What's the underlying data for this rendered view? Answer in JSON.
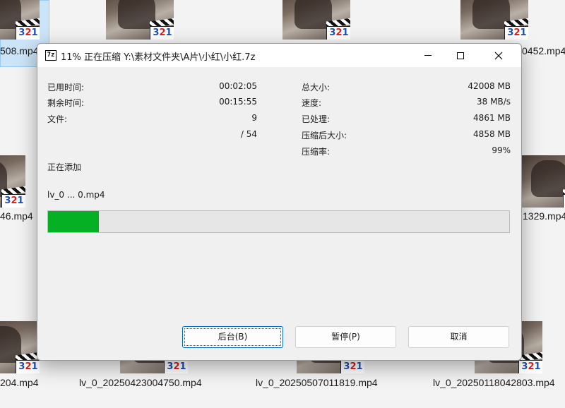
{
  "background": {
    "file_labels_top": [
      "508.mp4",
      "0452.mp4"
    ],
    "file_labels_middle": [
      "46.mp4",
      "1329.mp4"
    ],
    "file_labels_bottom": [
      "204.mp4",
      "lv_0_20250423004750.mp4",
      "lv_0_20250507011819.mp4",
      "lv_0_20250118042803.mp4"
    ],
    "badge_text": "321"
  },
  "dialog": {
    "title": "11% 正在压缩 Y:\\素材文件夹\\A片\\小红\\小红.7z",
    "app_icon_text": "7z",
    "left_stats": [
      {
        "label": "已用时间:",
        "value": "00:02:05"
      },
      {
        "label": "剩余时间:",
        "value": "00:15:55"
      },
      {
        "label": "文件:",
        "value": "9"
      },
      {
        "label": "",
        "value": "/ 54"
      }
    ],
    "right_stats": [
      {
        "label": "总大小:",
        "value": "42008 MB"
      },
      {
        "label": "速度:",
        "value": "38 MB/s"
      },
      {
        "label": "已处理:",
        "value": "4861 MB"
      },
      {
        "label": "压缩后大小:",
        "value": "4858 MB"
      },
      {
        "label": "压缩率:",
        "value": "99%"
      }
    ],
    "status_text": "正在添加",
    "current_file": "lv_0 ... 0.mp4",
    "progress_fraction": 0.11,
    "progress_color": "#06b025",
    "buttons": {
      "background": "后台(B)",
      "pause": "暂停(P)",
      "cancel": "取消"
    }
  }
}
